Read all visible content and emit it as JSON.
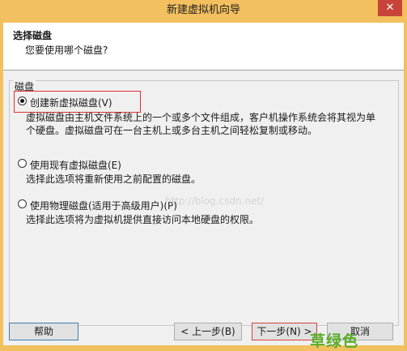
{
  "window": {
    "title": "新建虚拟机向导",
    "close_label": "✕"
  },
  "header": {
    "title": "选择磁盘",
    "subtitle": "您要使用哪个磁盘?"
  },
  "group": {
    "label": "磁盘",
    "options": [
      {
        "label": "创建新虚拟磁盘(V)",
        "description": "虚拟磁盘由主机文件系统上的一个或多个文件组成，客户机操作系统会将其视为单个硬盘。虚拟磁盘可在一台主机上或多台主机之间轻松复制或移动。",
        "checked": true
      },
      {
        "label": "使用现有虚拟磁盘(E)",
        "description": "选择此选项将重新使用之前配置的磁盘。",
        "checked": false
      },
      {
        "label": "使用物理磁盘(适用于高级用户)(P)",
        "description": "选择此选项将为虚拟机提供直接访问本地硬盘的权限。",
        "checked": false
      }
    ]
  },
  "watermark": "http://blog.csdn.net/",
  "buttons": {
    "help": "帮助",
    "back": "< 上一步(B)",
    "next": "下一步(N) >",
    "cancel": "取消"
  },
  "sticker": "草绿色"
}
